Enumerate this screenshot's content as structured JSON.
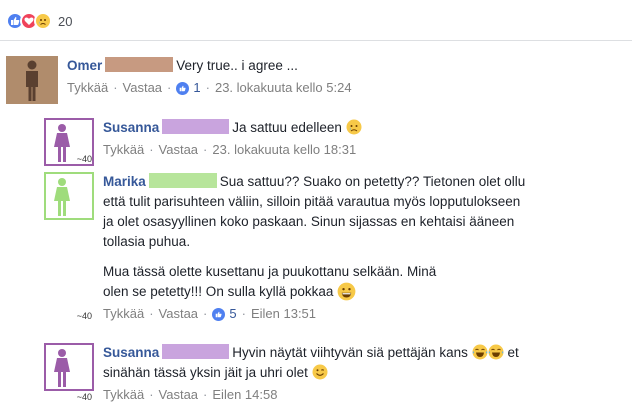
{
  "reactions": {
    "icons": [
      "like-icon",
      "love-icon",
      "sad-icon"
    ],
    "count": "20"
  },
  "actions_labels": {
    "like": "Tykkää",
    "reply": "Vastaa",
    "separator": "·"
  },
  "colors": {
    "author": "#365899",
    "meta": "#7f7f7f",
    "redact_omer": "#c79a81",
    "redact_susanna": "#c9a4de",
    "redact_marika": "#b7e59b",
    "avatar_male": "#b08c6c",
    "avatar_female_purple": "#9b5ca8",
    "avatar_female_green": "#9fdc7c",
    "like_blue": "#4f80f0"
  },
  "comments": [
    {
      "author": "Omer",
      "text": "Very true.. i agree ...",
      "likes": "1",
      "time": "23. lokakuuta kello 5:24"
    },
    {
      "author": "Susanna",
      "text": "Ja sattuu edelleen",
      "emoji": "sad-emoji",
      "time": "23. lokakuuta kello 18:31",
      "avatar_label": "~40"
    },
    {
      "author": "Marika",
      "lines": [
        "Sua sattuu?? Suako on petetty?? Tietonen olet ollu",
        "että tulit parisuhteen väliin, silloin pitää varautua myös lopputulokseen",
        "ja olet osasyyllinen koko paskaan. Sinun sijassas en kehtaisi ääneen",
        "tollasia puhua."
      ],
      "lines2": [
        "Mua tässä olette kusettanu ja puukottanu selkään. Minä",
        "olen se petetty!!! On sulla kyllä pokkaa"
      ],
      "emoji": "grin-emoji",
      "likes": "5",
      "time": "Eilen 13:51",
      "avatar_label": "~40"
    },
    {
      "author": "Susanna",
      "line1": "Hyvin näytät viihtyvän siä pettäjän kans",
      "line1_suffix": "et",
      "line2": "sinähän tässä yksin jäit ja uhri olet",
      "emojis": [
        "laughing-emoji",
        "laughing-emoji",
        "wink-emoji"
      ],
      "time": "Eilen 14:58",
      "avatar_label": "~40"
    }
  ]
}
